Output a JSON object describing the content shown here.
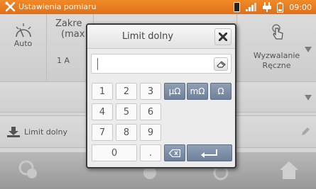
{
  "statusbar": {
    "title": "Ustawienia pomiaru",
    "time": "09:00"
  },
  "tiles": {
    "auto_label": "Auto",
    "range_label_line1": "Zakre",
    "range_label_line2": "(max",
    "range_value": "1 A",
    "trigger_label_line1": "Wyzwalanie",
    "trigger_label_line2": "Ręczne"
  },
  "rows": {
    "lower_limit_label": "Limit dolny"
  },
  "dialog": {
    "title": "Limit dolny",
    "input_value": "",
    "keys": {
      "k1": "1",
      "k2": "2",
      "k3": "3",
      "k4": "4",
      "k5": "5",
      "k6": "6",
      "k7": "7",
      "k8": "8",
      "k9": "9",
      "k0": "0",
      "dot": ".",
      "unit_micro": "µΩ",
      "unit_milli": "mΩ",
      "unit_ohm": "Ω"
    }
  },
  "colors": {
    "accent": "#e87b22",
    "unit_key": "#7f90a8"
  }
}
